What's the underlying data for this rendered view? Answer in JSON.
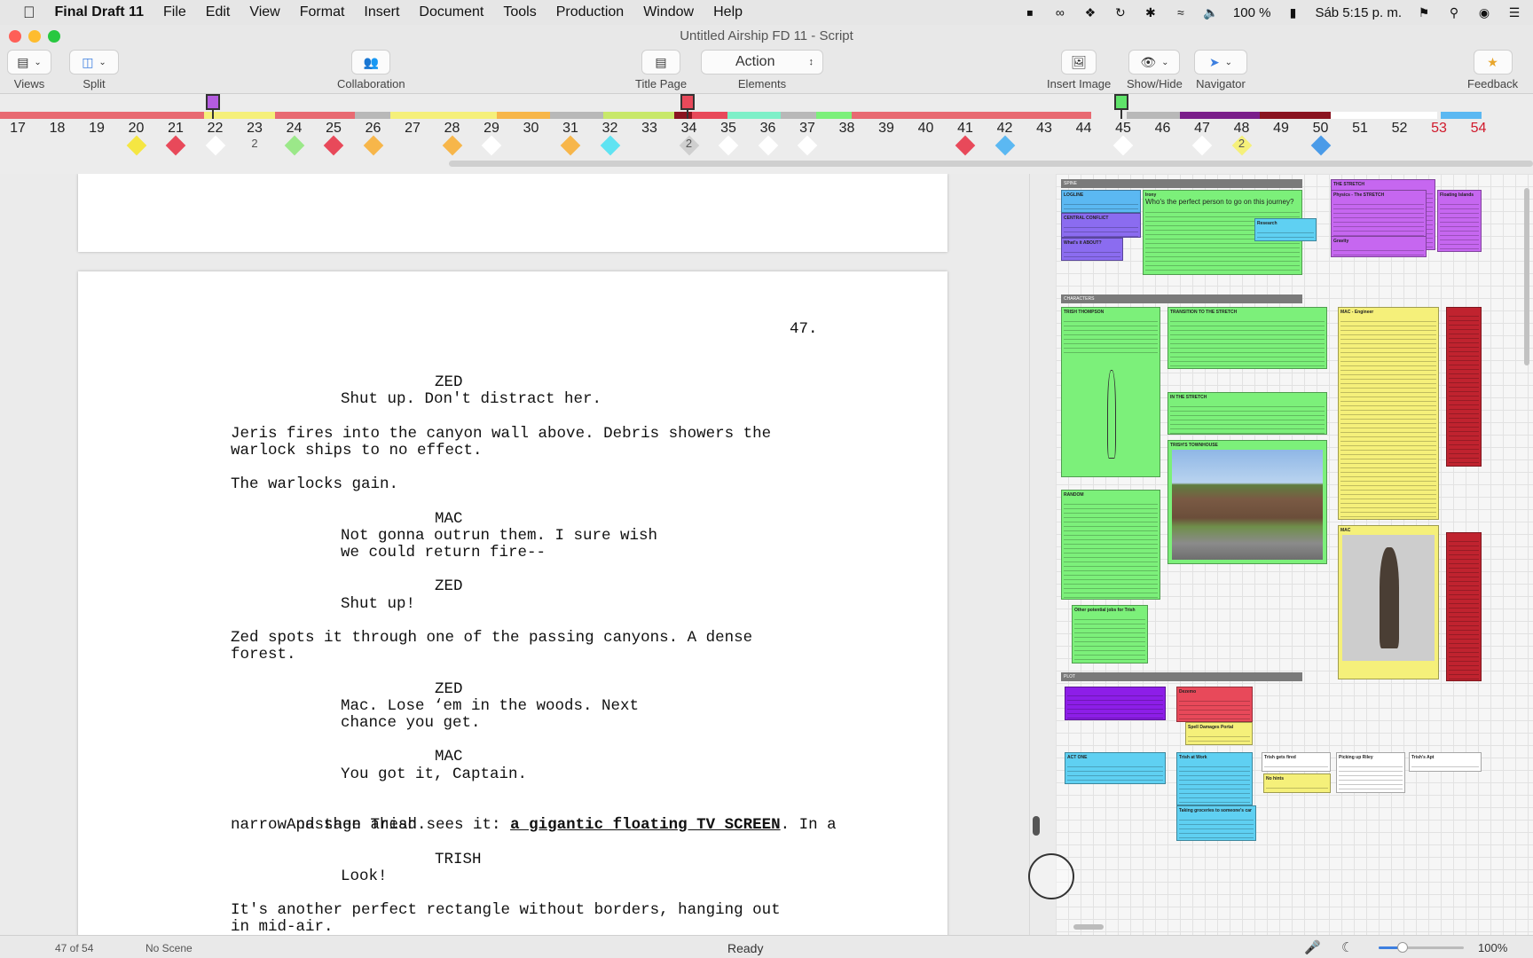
{
  "menubar": {
    "app_name": "Final Draft 11",
    "items": [
      "File",
      "Edit",
      "View",
      "Format",
      "Insert",
      "Document",
      "Tools",
      "Production",
      "Window",
      "Help"
    ],
    "battery": "100 %",
    "clock": "Sáb 5:15 p. m."
  },
  "window": {
    "title": "Untitled Airship FD 11 - Script"
  },
  "toolbar": {
    "views_label": "Views",
    "split_label": "Split",
    "collaboration_label": "Collaboration",
    "title_page_label": "Title Page",
    "elements_label": "Elements",
    "element_value": "Action",
    "insert_image_label": "Insert Image",
    "show_hide_label": "Show/Hide",
    "navigator_label": "Navigator",
    "feedback_label": "Feedback"
  },
  "timeline": {
    "pages": [
      "17",
      "18",
      "19",
      "20",
      "21",
      "22",
      "23",
      "24",
      "25",
      "26",
      "27",
      "28",
      "29",
      "30",
      "31",
      "32",
      "33",
      "34",
      "35",
      "36",
      "37",
      "38",
      "39",
      "40",
      "41",
      "42",
      "43",
      "44",
      "45",
      "46",
      "47",
      "48",
      "49",
      "50",
      "51",
      "52",
      "53",
      "54"
    ],
    "red_pages": [
      "53",
      "54"
    ],
    "current_page": "47",
    "diamonds": [
      {
        "page": "20",
        "color": "#f5e642"
      },
      {
        "page": "21",
        "color": "#e8495a"
      },
      {
        "page": "22",
        "color": "#ffffff"
      },
      {
        "page": "23",
        "label": "2"
      },
      {
        "page": "24",
        "color": "#9be889"
      },
      {
        "page": "25",
        "color": "#e8495a"
      },
      {
        "page": "26",
        "color": "#f7b64a"
      },
      {
        "page": "28",
        "color": "#f7b64a"
      },
      {
        "page": "29",
        "color": "#ffffff"
      },
      {
        "page": "31",
        "color": "#f7b64a"
      },
      {
        "page": "32",
        "color": "#5fe3f2"
      },
      {
        "page": "34",
        "color": "#cfcfcf",
        "label": "2"
      },
      {
        "page": "35",
        "color": "#ffffff"
      },
      {
        "page": "36",
        "color": "#ffffff"
      },
      {
        "page": "37",
        "color": "#ffffff"
      },
      {
        "page": "41",
        "color": "#e8495a"
      },
      {
        "page": "42",
        "color": "#5bb8f2"
      },
      {
        "page": "45",
        "color": "#ffffff"
      },
      {
        "page": "47",
        "color": "#ffffff"
      },
      {
        "page": "48",
        "color": "#f5f07a",
        "label": "2"
      },
      {
        "page": "50",
        "color": "#4a9be8"
      }
    ]
  },
  "script": {
    "page_number": "47.",
    "lines": [
      {
        "type": "character",
        "text": "ZED",
        "row": 0
      },
      {
        "type": "dialogue",
        "text": "Shut up. Don't distract her.",
        "row": 1
      },
      {
        "type": "action",
        "text": "Jeris fires into the canyon wall above. Debris showers the",
        "row": 3
      },
      {
        "type": "action",
        "text": "warlock ships to no effect.",
        "row": 4
      },
      {
        "type": "action",
        "text": "The warlocks gain.",
        "row": 6
      },
      {
        "type": "character",
        "text": "MAC",
        "row": 8
      },
      {
        "type": "dialogue",
        "text": "Not gonna outrun them. I sure wish",
        "row": 9
      },
      {
        "type": "dialogue",
        "text": "we could return fire--",
        "row": 10
      },
      {
        "type": "character",
        "text": "ZED",
        "row": 12
      },
      {
        "type": "dialogue",
        "text": "Shut up!",
        "row": 13
      },
      {
        "type": "action",
        "text": "Zed spots it through one of the passing canyons. A dense",
        "row": 15
      },
      {
        "type": "action",
        "text": "forest.",
        "row": 16
      },
      {
        "type": "character",
        "text": "ZED",
        "row": 18
      },
      {
        "type": "dialogue",
        "text": "Mac. Lose ‘em in the woods. Next",
        "row": 19
      },
      {
        "type": "dialogue",
        "text": "chance you get.",
        "row": 20
      },
      {
        "type": "character",
        "text": "MAC",
        "row": 22
      },
      {
        "type": "dialogue",
        "text": "You got it, Captain.",
        "row": 23
      },
      {
        "type": "character",
        "text": "TRISH",
        "row": 28
      },
      {
        "type": "dialogue",
        "text": "Look!",
        "row": 29
      },
      {
        "type": "action",
        "text": "It's another perfect rectangle without borders, hanging out",
        "row": 31
      },
      {
        "type": "action",
        "text": "in mid-air.",
        "row": 32
      }
    ],
    "mixed_line": {
      "row": 25,
      "pre": "And then Trish sees it: ",
      "emph": "a gigantic floating TV SCREEN",
      "post": ". In a"
    },
    "mixed_line2": {
      "row": 26,
      "text": "narrow passage ahead."
    }
  },
  "board": {
    "sections": [
      "SPINE",
      "CHARACTERS",
      "PLOT"
    ],
    "cards": [
      {
        "title": "LOGLINE",
        "color": "#5bb8f2"
      },
      {
        "title": "CENTRAL CONFLICT",
        "color": "#8b6cf0"
      },
      {
        "title": "What's it ABOUT?",
        "color": "#8b6cf0"
      },
      {
        "title": "Irony",
        "heading": "Who's the perfect person to go on this journey?",
        "color": "#7cf07a"
      },
      {
        "title": "Research",
        "color": "#5fd0f2"
      },
      {
        "title": "THE STRETCH",
        "color": "#c667f0"
      },
      {
        "title": "Physics - The STRETCH",
        "color": "#c667f0"
      },
      {
        "title": "Floating Islands",
        "color": "#c667f0"
      },
      {
        "title": "Gravity",
        "color": "#c667f0"
      },
      {
        "title": "TRISH THOMPSON",
        "color": "#7cf07a"
      },
      {
        "title": "TRANSITION TO THE STRETCH",
        "color": "#7cf07a"
      },
      {
        "title": "IN THE STRETCH",
        "color": "#7cf07a"
      },
      {
        "title": "TRISH'S TOWNHOUSE",
        "color": "#7cf07a"
      },
      {
        "title": "RANDOM",
        "color": "#7cf07a"
      },
      {
        "title": "Other potential jobs for Trish",
        "color": "#7cf07a"
      },
      {
        "title": "MAC - Engineer",
        "color": "#f5f07a"
      },
      {
        "title": "MAC",
        "color": "#f5f07a"
      },
      {
        "title": "ACT ONE",
        "color": "#5fd0f2"
      },
      {
        "title": "Trish at Work",
        "color": "#5fd0f2"
      },
      {
        "title": "Trish gets fired",
        "color": "#ffffff"
      },
      {
        "title": "Picking up Riley",
        "color": "#ffffff"
      },
      {
        "title": "Trish's Apt",
        "color": "#ffffff"
      },
      {
        "title": "No hints",
        "color": "#f5f07a"
      },
      {
        "title": "Dezemo",
        "color": "#e8495a"
      },
      {
        "title": "Spell Damages Portal",
        "color": "#f5f07a"
      },
      {
        "title": "Taking groceries to someone's car",
        "color": "#5fd0f2"
      }
    ]
  },
  "status": {
    "page_count": "47 of 54",
    "scene": "No Scene",
    "state": "Ready",
    "zoom": "100%",
    "zoom_fraction": 0.28
  }
}
